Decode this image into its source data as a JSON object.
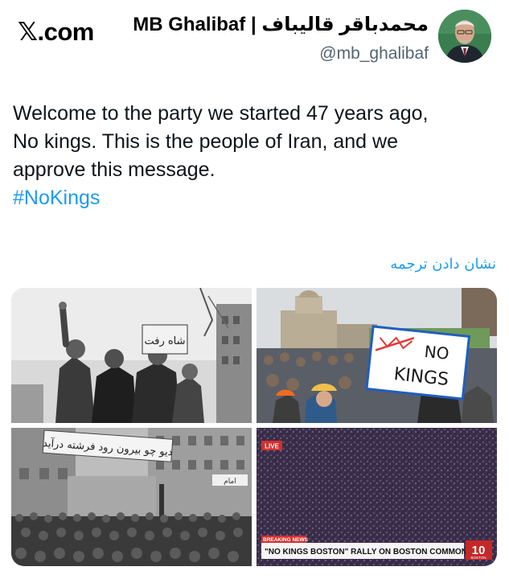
{
  "brand": {
    "text": ".com",
    "x_glyph": "𝕏"
  },
  "author": {
    "display_name": "MB Ghalibaf | محمدباقر قالیباف",
    "handle": "@mb_ghalibaf",
    "avatar_icon": "profile-photo"
  },
  "tweet": {
    "text_lines": [
      "Welcome to the party we started 47 years ago,",
      "No kings. This is the people of Iran, and we",
      "approve this message."
    ],
    "hashtag": "#NoKings",
    "translate_label": "نشان دادن ترجمه"
  },
  "media": {
    "photo1": {
      "sign_text": "شاه رفت"
    },
    "photo2": {
      "sign_line1": "NO",
      "sign_line2": "KINGS"
    },
    "photo3": {
      "banner_text": "دیو چو بیرون رود فرشته درآید",
      "small_sign": "امام"
    },
    "photo4": {
      "live_badge": "LIVE",
      "breaking": "BREAKING NEWS",
      "chyron": "\"NO KINGS BOSTON\" RALLY ON BOSTON COMMON",
      "channel_number": "10",
      "channel_city": "BOSTON"
    }
  },
  "colors": {
    "link": "#1d9bf0",
    "handle": "#536471",
    "text": "#0f1419"
  }
}
